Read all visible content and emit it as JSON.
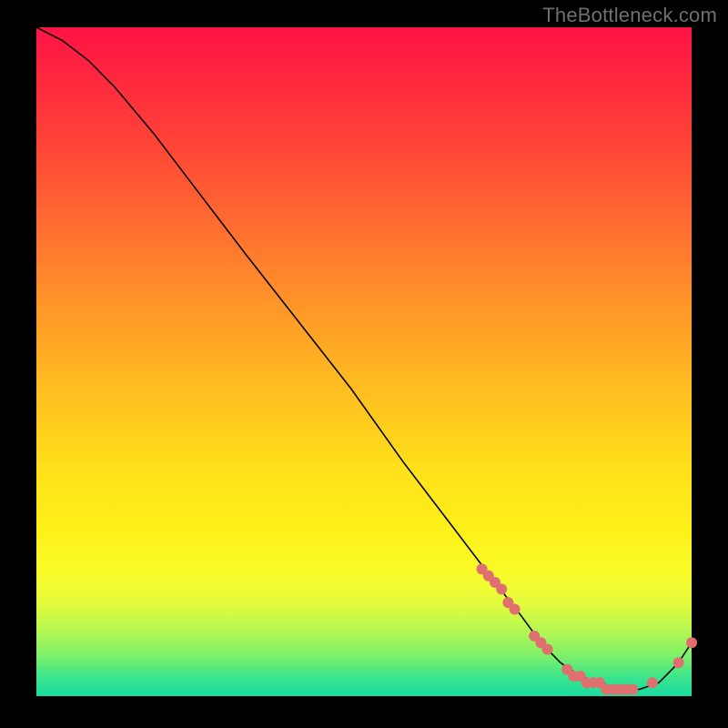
{
  "watermark": "TheBottleneck.com",
  "colors": {
    "point": "#e07070",
    "line": "#000000",
    "gradient_top": "#ff1446",
    "gradient_bottom": "#18dca0"
  },
  "chart_data": {
    "type": "line",
    "title": "",
    "xlabel": "",
    "ylabel": "",
    "xlim": [
      0,
      100
    ],
    "ylim": [
      0,
      100
    ],
    "grid": false,
    "legend": false,
    "series": [
      {
        "name": "bottleneck-curve",
        "x": [
          0,
          4,
          8,
          12,
          18,
          25,
          32,
          40,
          48,
          56,
          63,
          70,
          74,
          77,
          80,
          83,
          86,
          89,
          92,
          95,
          98,
          100
        ],
        "values": [
          100,
          98,
          95,
          91,
          84,
          75,
          66,
          56,
          46,
          35,
          26,
          17,
          12,
          8,
          5,
          3,
          2,
          1,
          1,
          2,
          5,
          8
        ]
      }
    ],
    "points": [
      {
        "name": "hw-point-1",
        "x": 68,
        "y": 19
      },
      {
        "name": "hw-point-2",
        "x": 69,
        "y": 18
      },
      {
        "name": "hw-point-3",
        "x": 70,
        "y": 17
      },
      {
        "name": "hw-point-4",
        "x": 71,
        "y": 16
      },
      {
        "name": "hw-point-5",
        "x": 72,
        "y": 14
      },
      {
        "name": "hw-point-6",
        "x": 73,
        "y": 13
      },
      {
        "name": "hw-point-7",
        "x": 76,
        "y": 9
      },
      {
        "name": "hw-point-8",
        "x": 77,
        "y": 8
      },
      {
        "name": "hw-point-9",
        "x": 78,
        "y": 7
      },
      {
        "name": "hw-point-10",
        "x": 81,
        "y": 4
      },
      {
        "name": "hw-point-11",
        "x": 82,
        "y": 3
      },
      {
        "name": "hw-point-12",
        "x": 83,
        "y": 3
      },
      {
        "name": "hw-point-13",
        "x": 84,
        "y": 2
      },
      {
        "name": "hw-point-14",
        "x": 85,
        "y": 2
      },
      {
        "name": "hw-point-15",
        "x": 86,
        "y": 2
      },
      {
        "name": "hw-point-16",
        "x": 87,
        "y": 1
      },
      {
        "name": "hw-point-17",
        "x": 88,
        "y": 1
      },
      {
        "name": "hw-point-18",
        "x": 89,
        "y": 1
      },
      {
        "name": "hw-point-19",
        "x": 90,
        "y": 1
      },
      {
        "name": "hw-point-20",
        "x": 91,
        "y": 1
      },
      {
        "name": "hw-point-21",
        "x": 94,
        "y": 2
      },
      {
        "name": "hw-point-22",
        "x": 98,
        "y": 5
      },
      {
        "name": "hw-point-23",
        "x": 100,
        "y": 8
      }
    ]
  }
}
